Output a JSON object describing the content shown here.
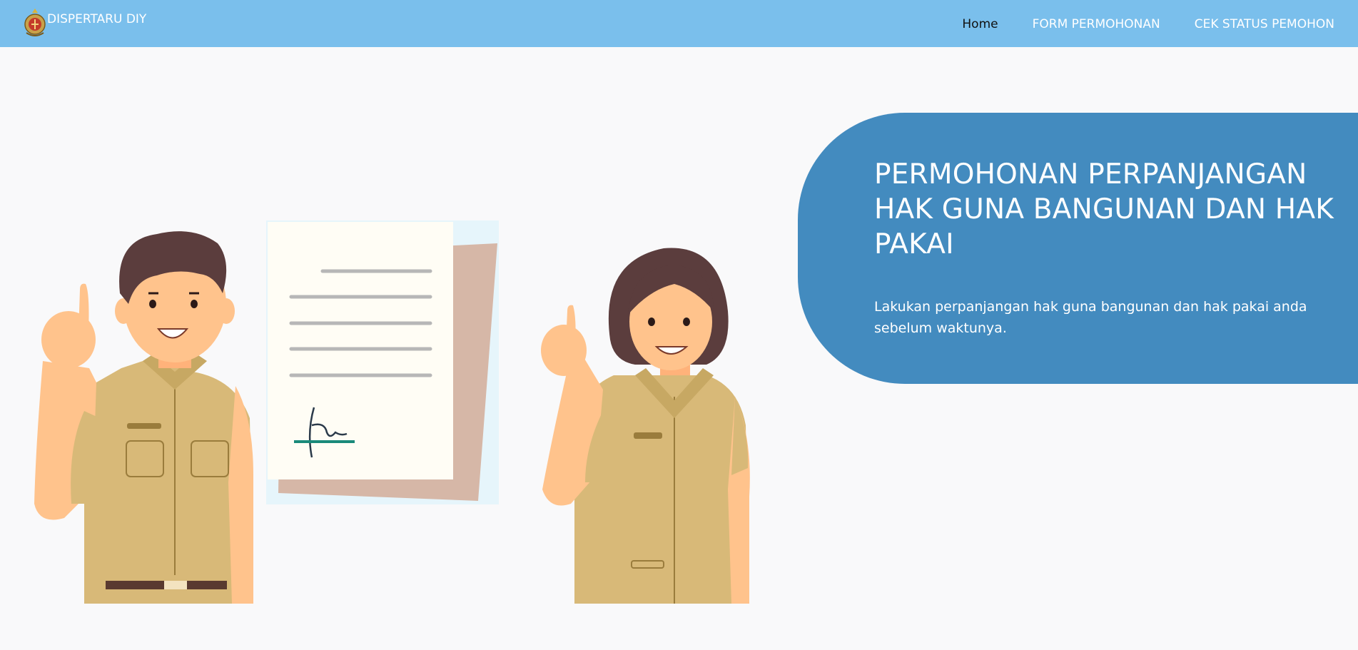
{
  "navbar": {
    "brand": "DISPERTARU DIY",
    "links": [
      {
        "label": "Home",
        "active": true
      },
      {
        "label": "FORM PERMOHONAN",
        "active": false
      },
      {
        "label": "CEK STATUS PEMOHON",
        "active": false
      }
    ]
  },
  "hero": {
    "title": "PERMOHONAN PERPANJANGAN HAK GUNA BANGUNAN DAN HAK PAKAI",
    "subtitle": "Lakukan perpanjangan hak guna bangunan dan hak pakai anda sebelum waktunya."
  },
  "illustration": {
    "subjects": [
      "officer-man-icon",
      "document-icon",
      "officer-woman-icon"
    ]
  },
  "colors": {
    "navbar": "#7abfec",
    "hero_panel": "#438bbf",
    "background": "#f9f9fa",
    "uniform": "#d8b978"
  }
}
